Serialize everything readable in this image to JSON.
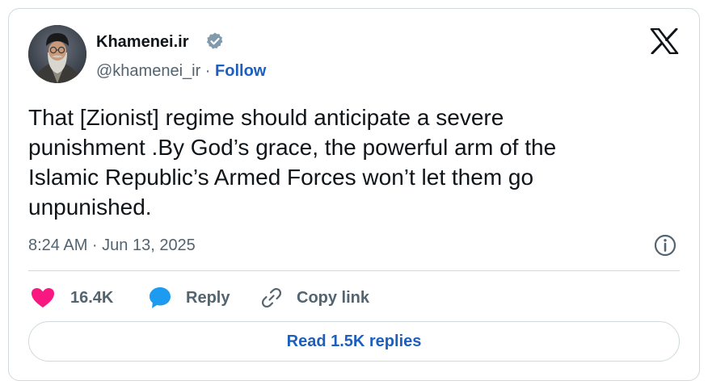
{
  "author": {
    "name": "Khamenei.ir",
    "handle": "@khamenei_ir",
    "separator": " · ",
    "follow_label": "Follow",
    "verified_icon": "verified-badge-icon"
  },
  "platform_logo": "x-logo-icon",
  "tweet": {
    "lines": [
      "That [Zionist] regime should anticipate a severe",
      "punishment .By God’s grace, the powerful arm of the",
      "Islamic Republic’s Armed Forces won’t let them go",
      "unpunished."
    ],
    "timestamp": "8:24 AM · Jun 13, 2025"
  },
  "actions": {
    "like_count": "16.4K",
    "reply_label": "Reply",
    "copy_link_label": "Copy link"
  },
  "read_replies_label": "Read 1.5K replies",
  "colors": {
    "accent": "#1d5fbf",
    "like": "#f91880",
    "reply": "#1d9bf0",
    "muted": "#536471",
    "border": "#cfd9de"
  }
}
